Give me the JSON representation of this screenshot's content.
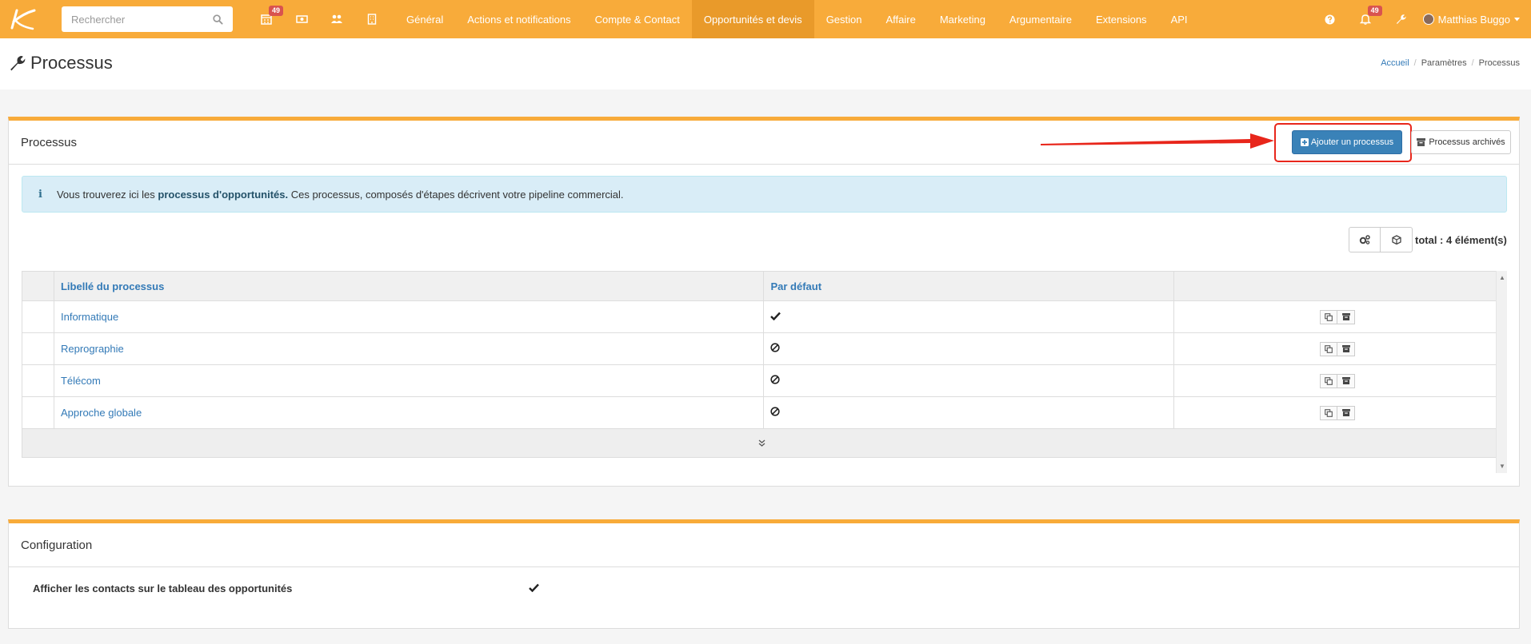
{
  "nav": {
    "search_placeholder": "Rechercher",
    "calendar_badge": "49",
    "notifications_badge": "49",
    "menu": [
      {
        "label": "Général",
        "active": false
      },
      {
        "label": "Actions et notifications",
        "active": false
      },
      {
        "label": "Compte & Contact",
        "active": false
      },
      {
        "label": "Opportunités et devis",
        "active": true
      },
      {
        "label": "Gestion",
        "active": false
      },
      {
        "label": "Affaire",
        "active": false
      },
      {
        "label": "Marketing",
        "active": false
      },
      {
        "label": "Argumentaire",
        "active": false
      },
      {
        "label": "Extensions",
        "active": false
      },
      {
        "label": "API",
        "active": false
      }
    ],
    "user_name": "Matthias Buggo"
  },
  "header": {
    "title": "Processus",
    "breadcrumb": [
      "Accueil",
      "Paramètres",
      "Processus"
    ]
  },
  "processes_panel": {
    "title": "Processus",
    "add_button": "Ajouter un processus",
    "archived_button": "Processus archivés",
    "alert_prefix": "Vous trouverez ici les ",
    "alert_bold": "processus d'opportunités.",
    "alert_suffix": " Ces processus, composés d'étapes décrivent votre pipeline commercial.",
    "total": "total : 4 élément(s)",
    "columns": [
      "",
      "Libellé du processus",
      "Par défaut",
      ""
    ],
    "rows": [
      {
        "label": "Informatique",
        "default": "check"
      },
      {
        "label": "Reprographie",
        "default": "ban"
      },
      {
        "label": "Télécom",
        "default": "ban"
      },
      {
        "label": "Approche globale",
        "default": "ban"
      }
    ]
  },
  "config_panel": {
    "title": "Configuration",
    "setting_label": "Afficher les contacts sur le tableau des opportunités",
    "setting_value": "check"
  },
  "colors": {
    "brand": "#f8ab3a",
    "primary": "#3a82b8",
    "highlight": "#e8261b"
  }
}
